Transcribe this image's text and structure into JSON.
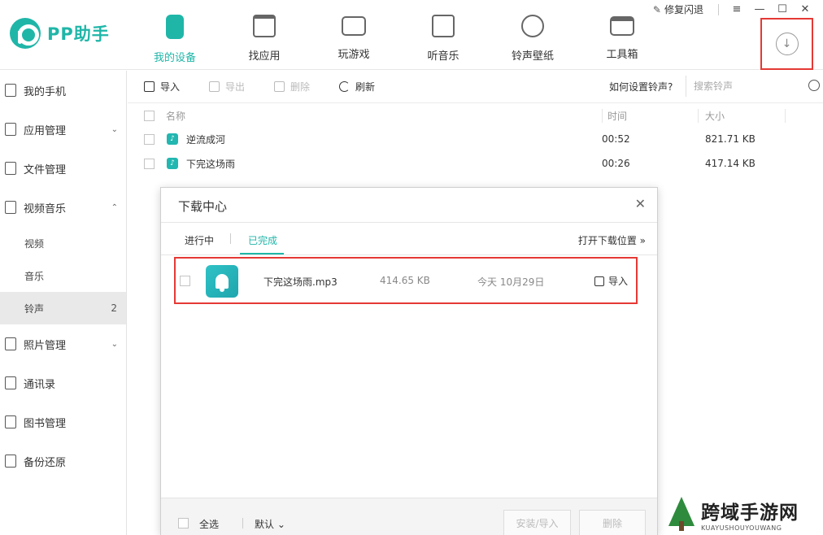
{
  "app": {
    "logo_text": "PP助手"
  },
  "nav": [
    {
      "label": "我的设备",
      "active": true
    },
    {
      "label": "找应用"
    },
    {
      "label": "玩游戏"
    },
    {
      "label": "听音乐"
    },
    {
      "label": "铃声壁纸"
    },
    {
      "label": "工具箱"
    }
  ],
  "window": {
    "repair_label": "修复闪退",
    "menu_icon": "≡",
    "minimize_icon": "—",
    "maximize_icon": "☐",
    "close_icon": "✕",
    "download_icon": "↓"
  },
  "sidebar": {
    "items": [
      {
        "label": "我的手机"
      },
      {
        "label": "应用管理",
        "arrow": "⌄"
      },
      {
        "label": "文件管理"
      },
      {
        "label": "视频音乐",
        "arrow": "⌃"
      }
    ],
    "subitems": [
      {
        "label": "视频"
      },
      {
        "label": "音乐"
      },
      {
        "label": "铃声",
        "count": "2",
        "active": true
      }
    ],
    "items2": [
      {
        "label": "照片管理",
        "arrow": "⌄"
      },
      {
        "label": "通讯录"
      },
      {
        "label": "图书管理"
      },
      {
        "label": "备份还原"
      }
    ]
  },
  "toolbar": {
    "import_label": "导入",
    "export_label": "导出",
    "delete_label": "删除",
    "refresh_label": "刷新",
    "howto_label": "如何设置铃声?",
    "search_placeholder": "搜索铃声"
  },
  "table": {
    "headers": {
      "name": "名称",
      "time": "时间",
      "size": "大小"
    },
    "rows": [
      {
        "name": "逆流成河",
        "time": "00:52",
        "size": "821.71 KB"
      },
      {
        "name": "下完这场雨",
        "time": "00:26",
        "size": "417.14 KB"
      }
    ]
  },
  "dialog": {
    "title": "下载中心",
    "close_icon": "✕",
    "tabs": [
      {
        "label": "进行中"
      },
      {
        "label": "已完成",
        "active": true
      }
    ],
    "open_location": "打开下载位置 »",
    "item": {
      "name": "下完这场雨.mp3",
      "size": "414.65 KB",
      "date": "今天 10月29日",
      "action": "导入"
    },
    "footer": {
      "select_all": "全选",
      "sort": "默认 ⌄",
      "install_import": "安装/导入",
      "delete": "删除"
    }
  },
  "watermark": {
    "big": "跨域手游网",
    "small": "KUAYUSHOUYOUWANG"
  },
  "colors": {
    "accent": "#1fb6a8",
    "highlight_box": "#e53935"
  }
}
